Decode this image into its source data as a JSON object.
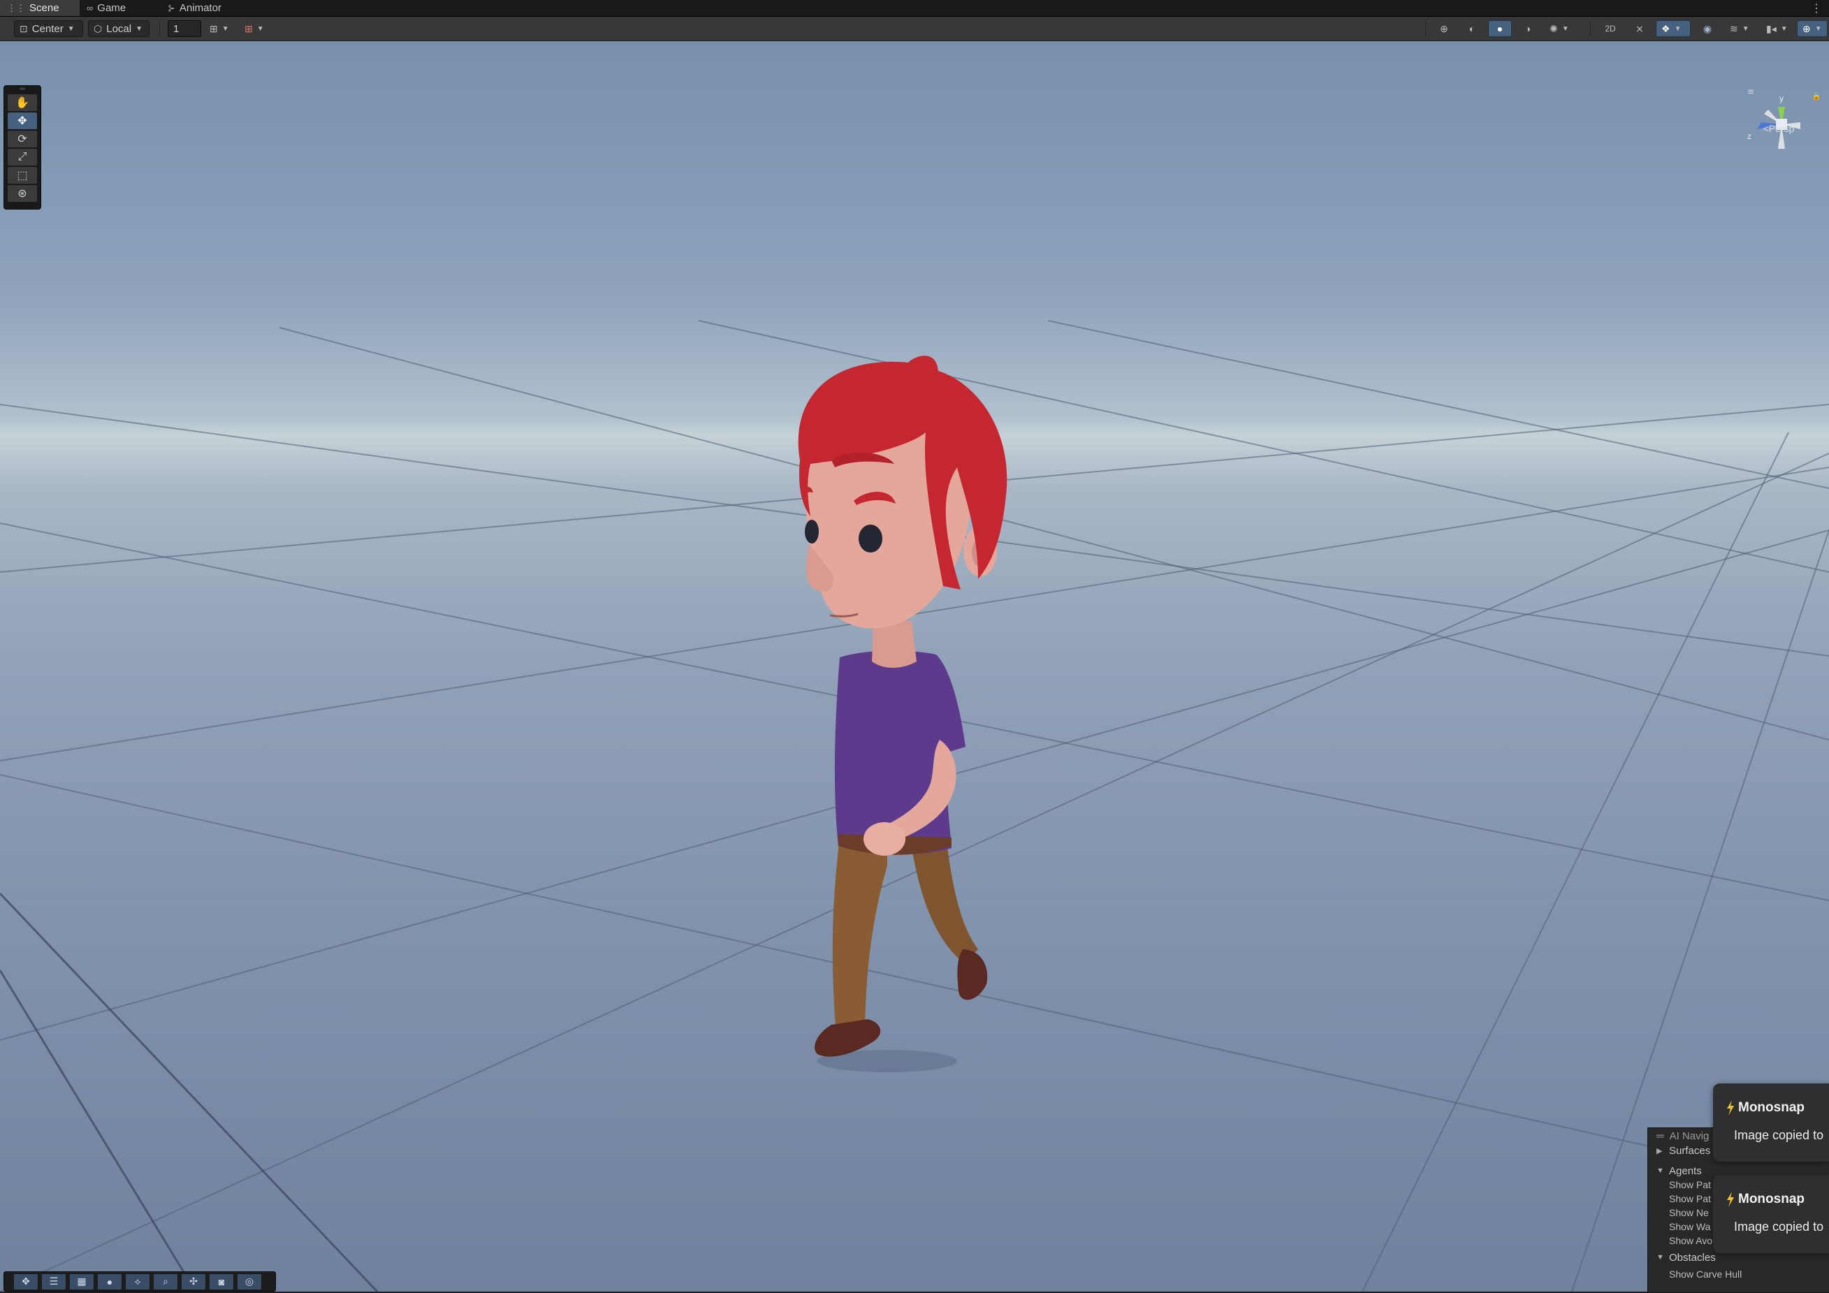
{
  "tabs": [
    {
      "label": "Scene",
      "icon": "grid-icon"
    },
    {
      "label": "Game",
      "icon": "gamepad-icon"
    },
    {
      "label": "Animator",
      "icon": "animator-icon"
    }
  ],
  "toolbar": {
    "pivot_mode": "Center",
    "pivot_rotation": "Local",
    "grid_snap_value": "1"
  },
  "tools": [
    "hand-tool",
    "move-tool",
    "rotate-tool",
    "scale-tool",
    "rect-tool",
    "transform-tool"
  ],
  "gizmo": {
    "y_label": "y",
    "z_label": "z",
    "projection": "<Persp"
  },
  "ai_navigation": {
    "title": "AI Navig",
    "surfaces": "Surfaces",
    "agents": "Agents",
    "agent_options": [
      "Show Pat",
      "Show Pat",
      "Show Ne",
      "Show Wa",
      "Show Avo"
    ],
    "obstacles": "Obstacles",
    "show_carve_hull": "Show Carve Hull"
  },
  "notifications": [
    {
      "app": "Monosnap",
      "message": "Image copied to"
    },
    {
      "app": "Monosnap",
      "message": "Image copied to"
    }
  ],
  "colors": {
    "accent_blue": "#46607f",
    "hair": "#c4272f",
    "shirt": "#5e3a8c",
    "pants": "#7f5530",
    "skin": "#e3a79c",
    "shoes": "#5a2a22"
  }
}
